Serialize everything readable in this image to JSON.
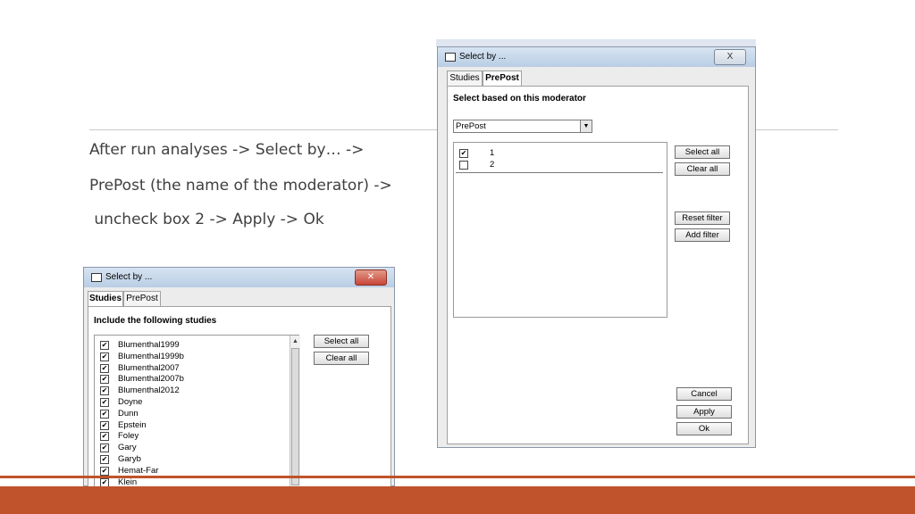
{
  "slide": {
    "lines": [
      "After run analyses -> Select by… ->",
      "PrePost (the name of the moderator) ->",
      " uncheck box 2 -> Apply -> Ok"
    ]
  },
  "dialog_left": {
    "title": "Select by ...",
    "tabs": [
      "Studies",
      "PrePost"
    ],
    "heading": "Include the following studies",
    "items": [
      {
        "label": "Blumenthal1999",
        "checked": true
      },
      {
        "label": "Blumenthal1999b",
        "checked": true
      },
      {
        "label": "Blumenthal2007",
        "checked": true
      },
      {
        "label": "Blumenthal2007b",
        "checked": true
      },
      {
        "label": "Blumenthal2012",
        "checked": true
      },
      {
        "label": "Doyne",
        "checked": true
      },
      {
        "label": "Dunn",
        "checked": true
      },
      {
        "label": "Epstein",
        "checked": true
      },
      {
        "label": "Foley",
        "checked": true
      },
      {
        "label": "Gary",
        "checked": true
      },
      {
        "label": "Garyb",
        "checked": true
      },
      {
        "label": "Hemat-Far",
        "checked": true
      },
      {
        "label": "Klein",
        "checked": true
      }
    ],
    "select_all": "Select all",
    "clear_all": "Clear all"
  },
  "dialog_right": {
    "title": "Select by ...",
    "tabs": [
      "Studies",
      "PrePost"
    ],
    "heading": "Select based on this moderator",
    "moderator": "PrePost",
    "items": [
      {
        "label": "1",
        "checked": true
      },
      {
        "label": "2",
        "checked": false
      }
    ],
    "select_all": "Select all",
    "clear_all": "Clear all",
    "reset_filter": "Reset filter",
    "add_filter": "Add filter",
    "cancel": "Cancel",
    "apply": "Apply",
    "ok": "Ok",
    "close": "X"
  },
  "colors": {
    "accent": "#c0532b",
    "text": "#404040",
    "rule": "#c9c9c9"
  },
  "icons": [
    "window-icon",
    "close-icon",
    "checkbox-icon",
    "dropdown-arrow-icon",
    "scroll-up-icon",
    "scroll-down-icon"
  ]
}
